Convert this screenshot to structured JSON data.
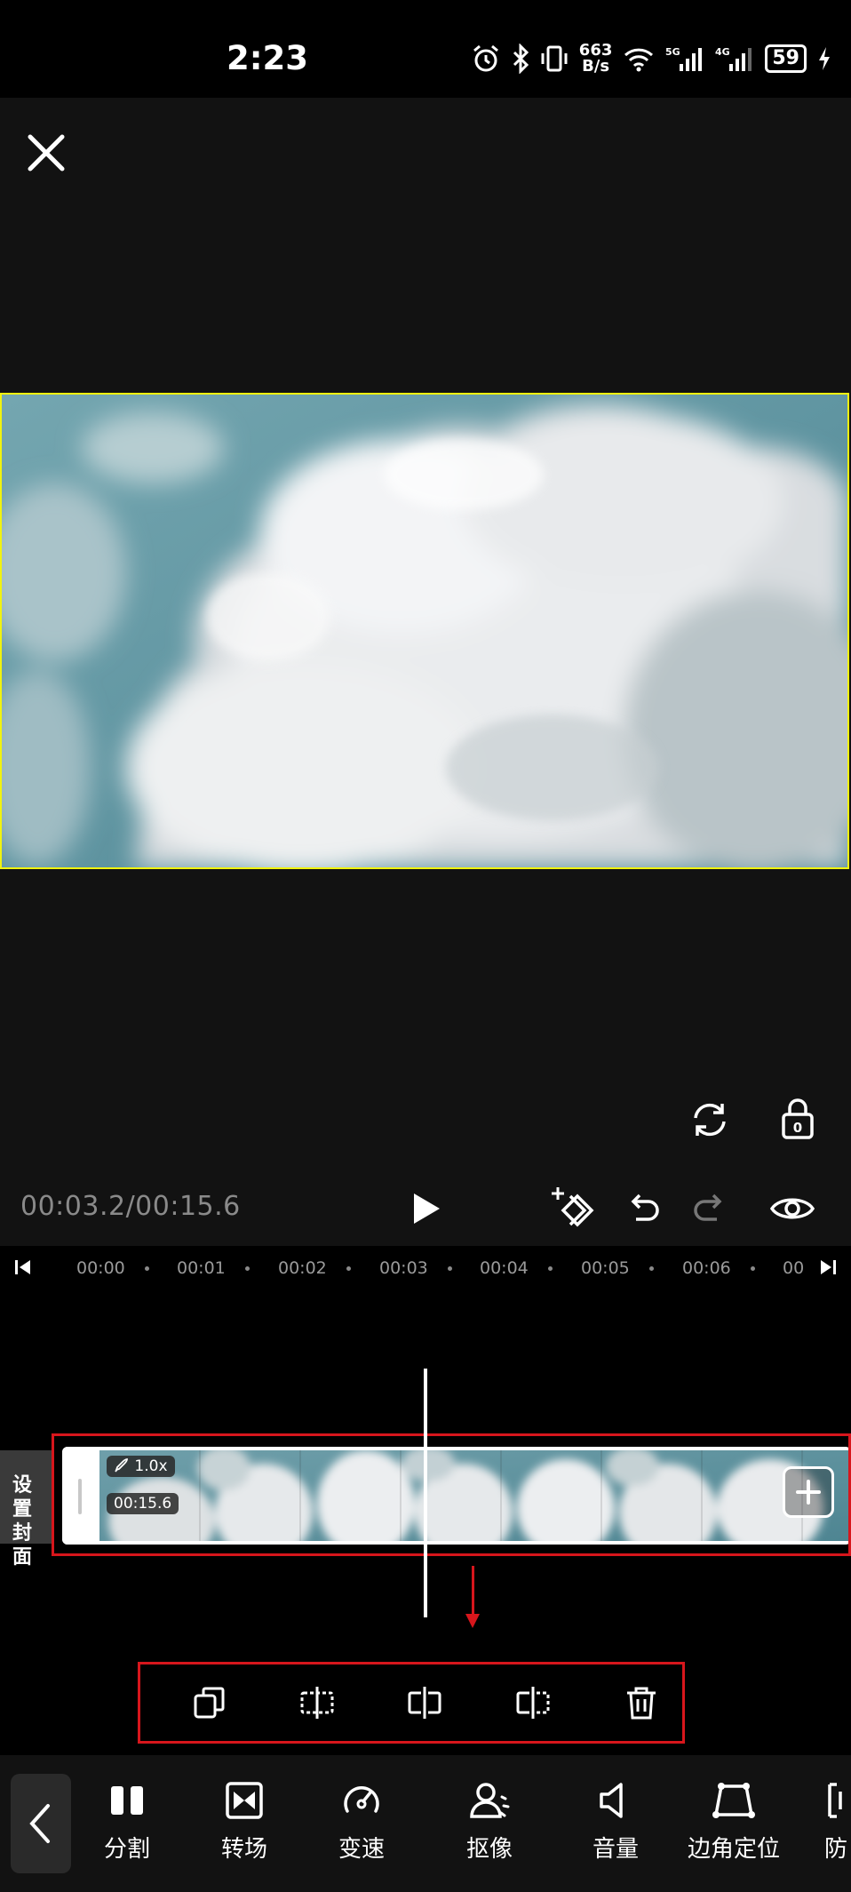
{
  "status_bar": {
    "time": "2:23",
    "net_speed_value": "663",
    "net_speed_unit": "B/s",
    "sig1_label": "5G",
    "sig2_label": "4G",
    "battery": "59"
  },
  "player": {
    "time_readout": "00:03.2/00:15.6",
    "lock_count": "0"
  },
  "ruler": {
    "ticks": [
      "00:00",
      "00:01",
      "00:02",
      "00:03",
      "00:04",
      "00:05",
      "00:06",
      "00"
    ]
  },
  "timeline": {
    "cover_label": "设置封面",
    "speed_badge": "1.0x",
    "duration_badge": "00:15.6"
  },
  "toolbar": {
    "items": [
      {
        "label": "分割",
        "icon": "split-icon"
      },
      {
        "label": "转场",
        "icon": "transition-icon"
      },
      {
        "label": "变速",
        "icon": "speed-icon"
      },
      {
        "label": "抠像",
        "icon": "cutout-icon"
      },
      {
        "label": "音量",
        "icon": "volume-icon"
      },
      {
        "label": "边角定位",
        "icon": "corner-pin-icon"
      },
      {
        "label": "防",
        "icon": "stabilize-icon"
      }
    ]
  },
  "colors": {
    "preview_border": "#f1f30f",
    "annotation_red": "#d7161c",
    "background": "#121212"
  }
}
